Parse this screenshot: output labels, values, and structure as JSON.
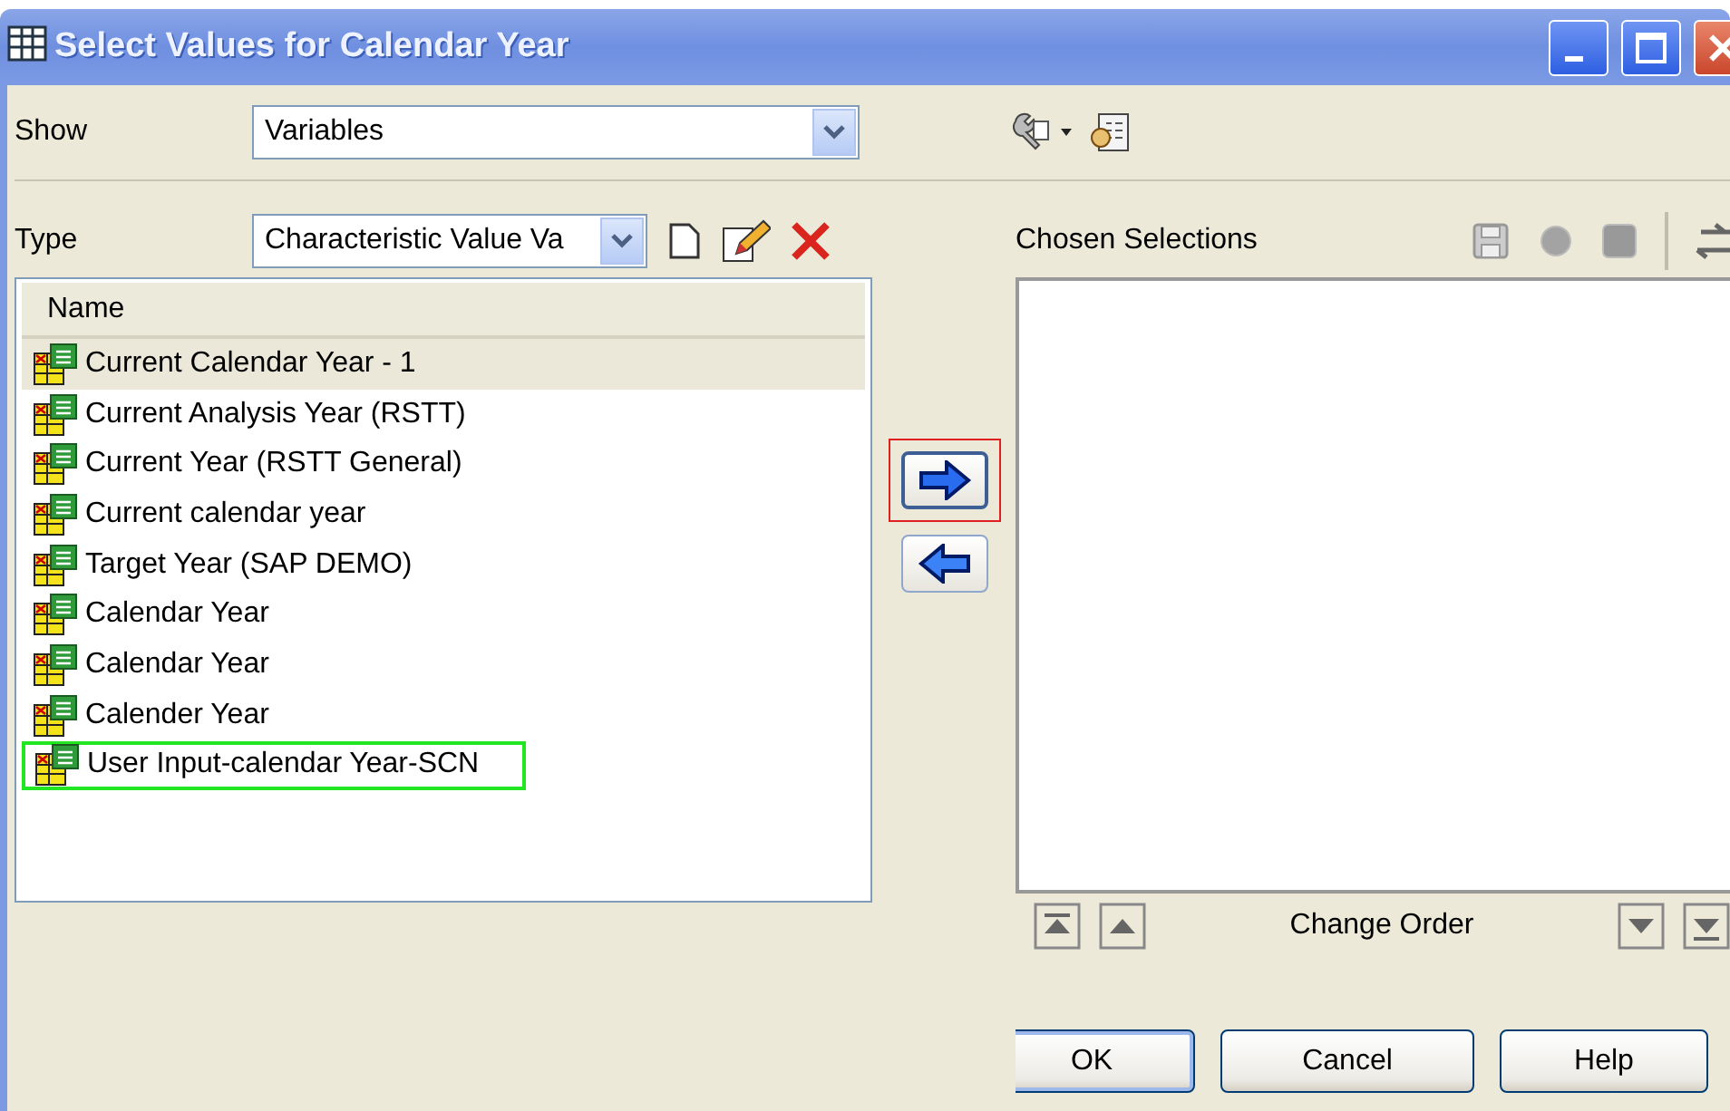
{
  "window": {
    "title": "Select Values for Calendar Year"
  },
  "show": {
    "label": "Show",
    "value": "Variables"
  },
  "type": {
    "label": "Type",
    "value": "Characteristic Value Va"
  },
  "list": {
    "header": "Name",
    "items": [
      {
        "label": "Current Calendar Year - 1",
        "selected": true,
        "focused": false
      },
      {
        "label": "Current Analysis Year (RSTT)",
        "selected": false,
        "focused": false
      },
      {
        "label": "Current Year (RSTT General)",
        "selected": false,
        "focused": false
      },
      {
        "label": "Current calendar year",
        "selected": false,
        "focused": false
      },
      {
        "label": "Target Year (SAP DEMO)",
        "selected": false,
        "focused": false
      },
      {
        "label": "Calendar Year",
        "selected": false,
        "focused": false
      },
      {
        "label": "Calendar Year",
        "selected": false,
        "focused": false
      },
      {
        "label": "Calender Year",
        "selected": false,
        "focused": false
      },
      {
        "label": "User Input-calendar Year-SCN",
        "selected": false,
        "focused": true
      }
    ]
  },
  "move_buttons": [
    {
      "kind": "add",
      "highlighted": true
    },
    {
      "kind": "remove",
      "highlighted": false
    }
  ],
  "chosen": {
    "title": "Chosen Selections",
    "order_label": "Change Order"
  },
  "buttons": [
    {
      "label": "OK",
      "default": true
    },
    {
      "label": "Cancel",
      "default": false
    },
    {
      "label": "Help",
      "default": false
    }
  ]
}
